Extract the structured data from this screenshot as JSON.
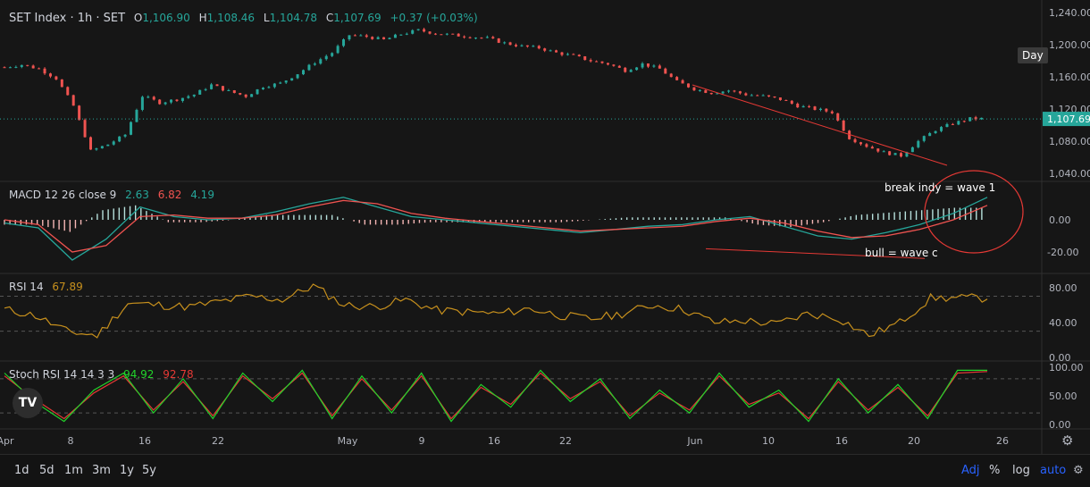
{
  "header": {
    "symbol": "SET Index · 1h · SET",
    "o_label": "O",
    "o_value": "1,106.90",
    "h_label": "H",
    "h_value": "1,108.46",
    "l_label": "L",
    "l_value": "1,104.78",
    "c_label": "C",
    "c_value": "1,107.69",
    "change": "+0.37 (+0.03%)"
  },
  "interval_tag": "Day",
  "price_axis": {
    "ticks": [
      "1,240.00",
      "1,200.00",
      "1,160.00",
      "1,120.00",
      "1,080.00",
      "1,040.00"
    ],
    "last_price": "1,107.69"
  },
  "macd": {
    "label": "MACD 12 26 close 9",
    "v1": "2.63",
    "v2": "6.82",
    "v3": "4.19",
    "ticks": [
      "0.00",
      "-20.00"
    ]
  },
  "rsi": {
    "label": "RSI 14",
    "value": "67.89",
    "ticks": [
      "80.00",
      "40.00",
      "0.00"
    ]
  },
  "stoch": {
    "label": "Stoch RSI 14 14 3 3",
    "k": "94.92",
    "d": "92.78",
    "ticks": [
      "100.00",
      "50.00",
      "0.00"
    ]
  },
  "time_axis": [
    "Apr",
    "8",
    "16",
    "22",
    "May",
    "9",
    "16",
    "22",
    "Jun",
    "10",
    "16",
    "20",
    "26"
  ],
  "annotations": {
    "wave1": "break indy = wave 1",
    "wavec": "bull = wave c"
  },
  "logo_text": "TV",
  "bottom": {
    "ranges": [
      "1d",
      "5d",
      "1m",
      "3m",
      "1y",
      "5y"
    ],
    "adj": "Adj",
    "pct": "%",
    "log": "log",
    "auto": "auto"
  },
  "colors": {
    "up": "#26a69a",
    "down": "#ef5350",
    "rsi": "#c7901d",
    "k": "#22d32b",
    "d": "#e53935",
    "annot": "#e53935"
  },
  "chart_data": [
    {
      "type": "candlestick",
      "title": "SET Index · 1h · SET",
      "x": [
        "Apr",
        "8",
        "16",
        "22",
        "May",
        "9",
        "16",
        "22",
        "Jun",
        "10",
        "16",
        "20",
        "26"
      ],
      "ylim": [
        1030,
        1250
      ],
      "series": [
        {
          "name": "SET Index",
          "close_path": [
            1172,
            1175,
            1170,
            1158,
            1124,
            1068,
            1076,
            1088,
            1136,
            1128,
            1132,
            1138,
            1150,
            1142,
            1136,
            1148,
            1152,
            1164,
            1178,
            1190,
            1212,
            1210,
            1206,
            1213,
            1218,
            1214,
            1212,
            1210,
            1208,
            1202,
            1198,
            1196,
            1190,
            1186,
            1180,
            1176,
            1168,
            1176,
            1170,
            1154,
            1145,
            1140,
            1143,
            1138,
            1136,
            1132,
            1124,
            1120,
            1116,
            1084,
            1074,
            1066,
            1062,
            1080,
            1094,
            1102,
            1108
          ]
        }
      ]
    },
    {
      "type": "line",
      "title": "MACD 12 26 close 9",
      "ylim": [
        -30,
        20
      ],
      "series": [
        {
          "name": "MACD",
          "values": [
            -2,
            -5,
            -25,
            -12,
            8,
            2,
            0,
            1,
            5,
            10,
            14,
            8,
            2,
            0,
            -2,
            -4,
            -6,
            -8,
            -6,
            -4,
            -3,
            0,
            2,
            -4,
            -10,
            -12,
            -8,
            -3,
            4,
            14
          ]
        },
        {
          "name": "Signal",
          "values": [
            0,
            -3,
            -20,
            -16,
            2,
            3,
            1,
            1,
            3,
            8,
            12,
            10,
            4,
            1,
            -1,
            -3,
            -5,
            -7,
            -6,
            -5,
            -4,
            -1,
            1,
            -2,
            -7,
            -11,
            -10,
            -6,
            0,
            9
          ]
        }
      ]
    },
    {
      "type": "line",
      "title": "RSI 14",
      "ylim": [
        0,
        90
      ],
      "series": [
        {
          "name": "RSI",
          "values": [
            55,
            48,
            30,
            25,
            62,
            60,
            58,
            64,
            70,
            66,
            82,
            60,
            58,
            66,
            54,
            52,
            50,
            56,
            48,
            44,
            50,
            60,
            55,
            40,
            42,
            38,
            50,
            45,
            25,
            40,
            68,
            68
          ]
        }
      ]
    },
    {
      "type": "line",
      "title": "Stoch RSI 14 14 3 3",
      "ylim": [
        -5,
        105
      ],
      "series": [
        {
          "name": "K",
          "values": [
            90,
            40,
            5,
            60,
            90,
            20,
            80,
            10,
            90,
            40,
            95,
            10,
            85,
            20,
            90,
            5,
            70,
            30,
            95,
            40,
            80,
            10,
            60,
            20,
            90,
            30,
            60,
            5,
            80,
            20,
            70,
            10,
            95,
            94.92
          ]
        },
        {
          "name": "D",
          "values": [
            85,
            45,
            10,
            55,
            85,
            25,
            75,
            15,
            85,
            45,
            90,
            15,
            80,
            25,
            85,
            10,
            65,
            35,
            90,
            45,
            75,
            15,
            55,
            25,
            85,
            35,
            55,
            10,
            75,
            25,
            65,
            15,
            90,
            92.78
          ]
        }
      ]
    }
  ]
}
